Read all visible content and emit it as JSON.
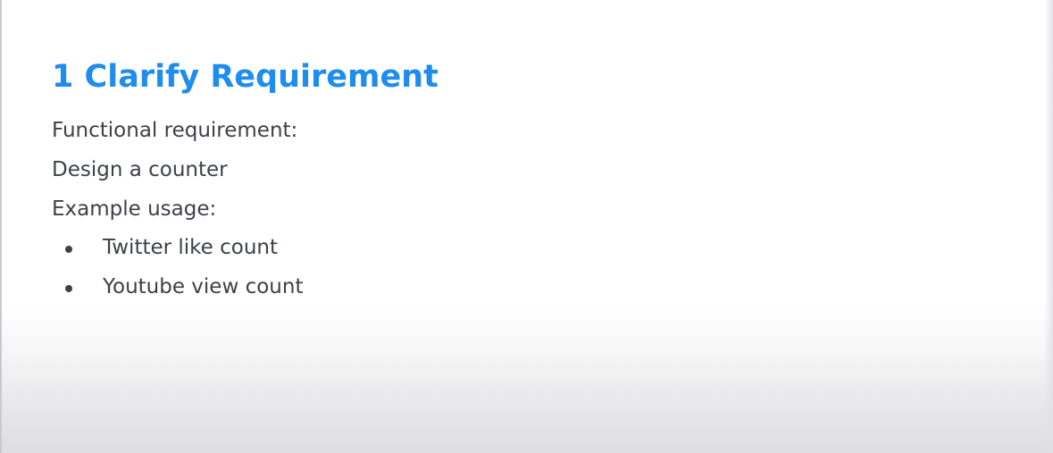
{
  "slide": {
    "title": "1 Clarify Requirement",
    "lines": [
      "Functional requirement:",
      "Design a counter",
      "Example usage:"
    ],
    "bullets": [
      "Twitter like count",
      "Youtube view count"
    ],
    "colors": {
      "title": "#1f8ded",
      "body_text": "#3d4147",
      "background": "#ffffff"
    }
  }
}
